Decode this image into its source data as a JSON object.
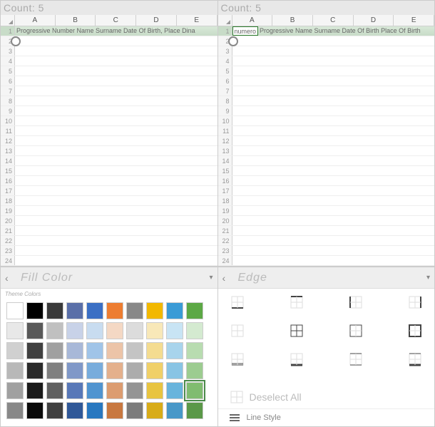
{
  "leftPane": {
    "count_label": "Count: 5",
    "columns": [
      "A",
      "B",
      "C",
      "D",
      "E"
    ],
    "header_row": "Progressive Number Name Surname Date Of Birth, Place Dina",
    "row_numbers": [
      1,
      2,
      3,
      4,
      5,
      6,
      7,
      8,
      9,
      10,
      11,
      12,
      13,
      14,
      15,
      16,
      17,
      18,
      19,
      20,
      21,
      22,
      23,
      24
    ]
  },
  "rightPane": {
    "count_label": "Count: 5",
    "columns": [
      "A",
      "B",
      "C",
      "D",
      "E"
    ],
    "first_cell": "numero",
    "header_row": "Progressive Name Surname Date Of Birth Place Of Birth",
    "row_numbers": [
      1,
      2,
      3,
      4,
      5,
      6,
      7,
      8,
      9,
      10,
      11,
      12,
      13,
      14,
      15,
      16,
      17,
      18,
      19,
      20,
      21,
      22,
      23,
      24
    ]
  },
  "fillColor": {
    "title": "Fill Color",
    "section": "Theme Colors",
    "rows": [
      [
        "#ffffff",
        "#000000",
        "#3a3a3a",
        "#5a6fa8",
        "#3b6fc4",
        "#ed7d31",
        "#888888",
        "#f2b800",
        "#3a9bd6",
        "#5ca845"
      ],
      [
        "#e8e8e8",
        "#595959",
        "#c0c0c0",
        "#c8d2e8",
        "#c8dcf0",
        "#f4d8c4",
        "#dcdcdc",
        "#f8e8b8",
        "#c8e4f4",
        "#d4ead0"
      ],
      [
        "#d0d0d0",
        "#404040",
        "#a0a0a0",
        "#a8b8d8",
        "#a0c4e8",
        "#ecc4a8",
        "#c4c4c4",
        "#f4dc90",
        "#a8d4ec",
        "#b8dcb0"
      ],
      [
        "#b8b8b8",
        "#2a2a2a",
        "#808080",
        "#8098c8",
        "#78acdc",
        "#e4b08c",
        "#acacac",
        "#f0d068",
        "#88c4e4",
        "#9ccc90"
      ],
      [
        "#a0a0a0",
        "#1a1a1a",
        "#606060",
        "#5878b8",
        "#5094d0",
        "#dc9c70",
        "#949494",
        "#e8c440",
        "#68b4dc",
        "#80bc70"
      ],
      [
        "#888888",
        "#0a0a0a",
        "#404040",
        "#305898",
        "#2878c0",
        "#c87840",
        "#7c7c7c",
        "#d8ac18",
        "#4898c8",
        "#5a9848"
      ]
    ],
    "selected": [
      4,
      9
    ]
  },
  "edge": {
    "title": "Edge",
    "deselect_label": "Deselect All",
    "linestyle_label": "Line Style"
  }
}
